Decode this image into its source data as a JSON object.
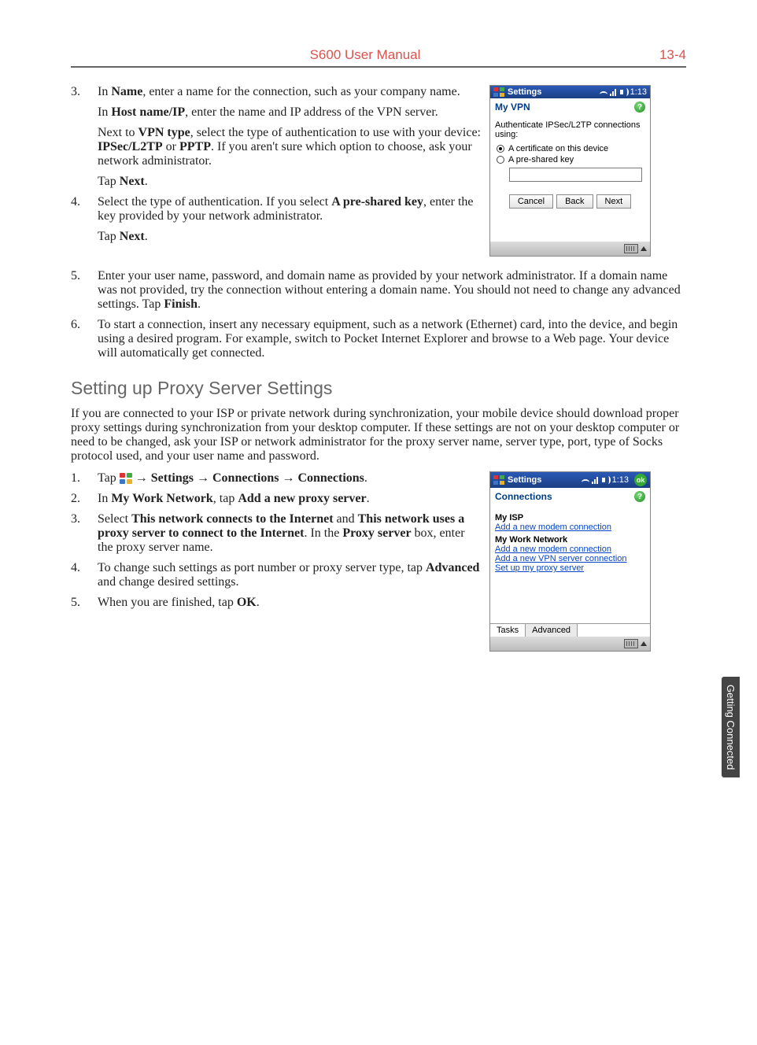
{
  "header": {
    "title": "S600 User Manual",
    "page": "13-4"
  },
  "side_tab": "Getting Connected",
  "steps_a": {
    "s3": {
      "p1a": "In ",
      "p1b": "Name",
      "p1c": ", enter a name for the connection, such as your company name.",
      "p2a": "In ",
      "p2b": "Host name/IP",
      "p2c": ", enter the name and IP address of the  VPN server.",
      "p3a": "Next to ",
      "p3b": "VPN type",
      "p3c": ", select the type of authentication to use with your device: ",
      "p3d": "IPSec/L2TP",
      "p3e": " or ",
      "p3f": "PPTP",
      "p3g": ". If you aren't sure which option to choose, ask your network administrator.",
      "p4a": "Tap ",
      "p4b": "Next",
      "p4c": "."
    },
    "s4": {
      "p1a": "Select the type of authentication. If you select ",
      "p1b": "A pre-shared key",
      "p1c": ", enter the key provided by your network administrator.",
      "p2a": "Tap ",
      "p2b": "Next",
      "p2c": "."
    },
    "s5": {
      "p1a": "Enter your user name, password, and domain name as provided by your network administrator. If a domain name was not provided, try the connection without entering a domain name. You should not need to change any advanced settings. Tap ",
      "p1b": "Finish",
      "p1c": "."
    },
    "s6": {
      "p1": "To start a connection, insert any necessary equipment, such as a network (Ethernet) card, into the device, and begin using a desired program. For example, switch to Pocket Internet Explorer and browse to a Web page. Your device will automatically get connected."
    }
  },
  "section_heading": "Setting up Proxy Server Settings",
  "section_para": "If you are connected to your ISP or private network during synchronization, your mobile device should download proper proxy settings during synchronization from your desktop computer. If these settings are not on your desktop computer or need to be changed, ask your ISP or network administrator for the proxy server name, server type, port, type of Socks protocol used, and your user name and password.",
  "steps_b": {
    "s1": {
      "pre": "Tap ",
      "arrow1": " → ",
      "b1": "Settings",
      "arrow2": " → ",
      "b2": "Connections",
      "arrow3": " → ",
      "b3": "Connections",
      "post": "."
    },
    "s2": {
      "p1a": "In ",
      "p1b": "My Work Network",
      "p1c": ", tap ",
      "p1d": "Add a new proxy server",
      "p1e": "."
    },
    "s3": {
      "p1a": "Select ",
      "p1b": "This network connects to the Internet",
      "p1c": " and ",
      "p1d": "This network uses a proxy server to connect to the Internet",
      "p1e": ". In the ",
      "p1f": "Proxy server",
      "p1g": " box, enter the proxy server name."
    },
    "s4": {
      "p1a": "To change such settings as port number or proxy server type, tap ",
      "p1b": "Advanced",
      "p1c": " and change desired settings."
    },
    "s5": {
      "p1a": "When you are finished, tap ",
      "p1b": "OK",
      "p1c": "."
    }
  },
  "device1": {
    "title": "Settings",
    "time": "1:13",
    "subtitle": "My VPN",
    "help": "?",
    "prompt": "Authenticate IPSec/L2TP connections using:",
    "radio1": "A certificate on this device",
    "radio2": "A pre-shared key",
    "btn_cancel": "Cancel",
    "btn_back": "Back",
    "btn_next": "Next"
  },
  "device2": {
    "title": "Settings",
    "time": "1:13",
    "ok": "ok",
    "subtitle": "Connections",
    "help": "?",
    "myisp_hd": "My ISP",
    "myisp_link": "Add a new modem connection",
    "mywork_hd": "My Work Network",
    "mywork_l1": "Add a new modem connection",
    "mywork_l2": "Add a new VPN server connection",
    "mywork_l3": "Set up my proxy server",
    "tab_tasks": "Tasks",
    "tab_adv": "Advanced"
  }
}
